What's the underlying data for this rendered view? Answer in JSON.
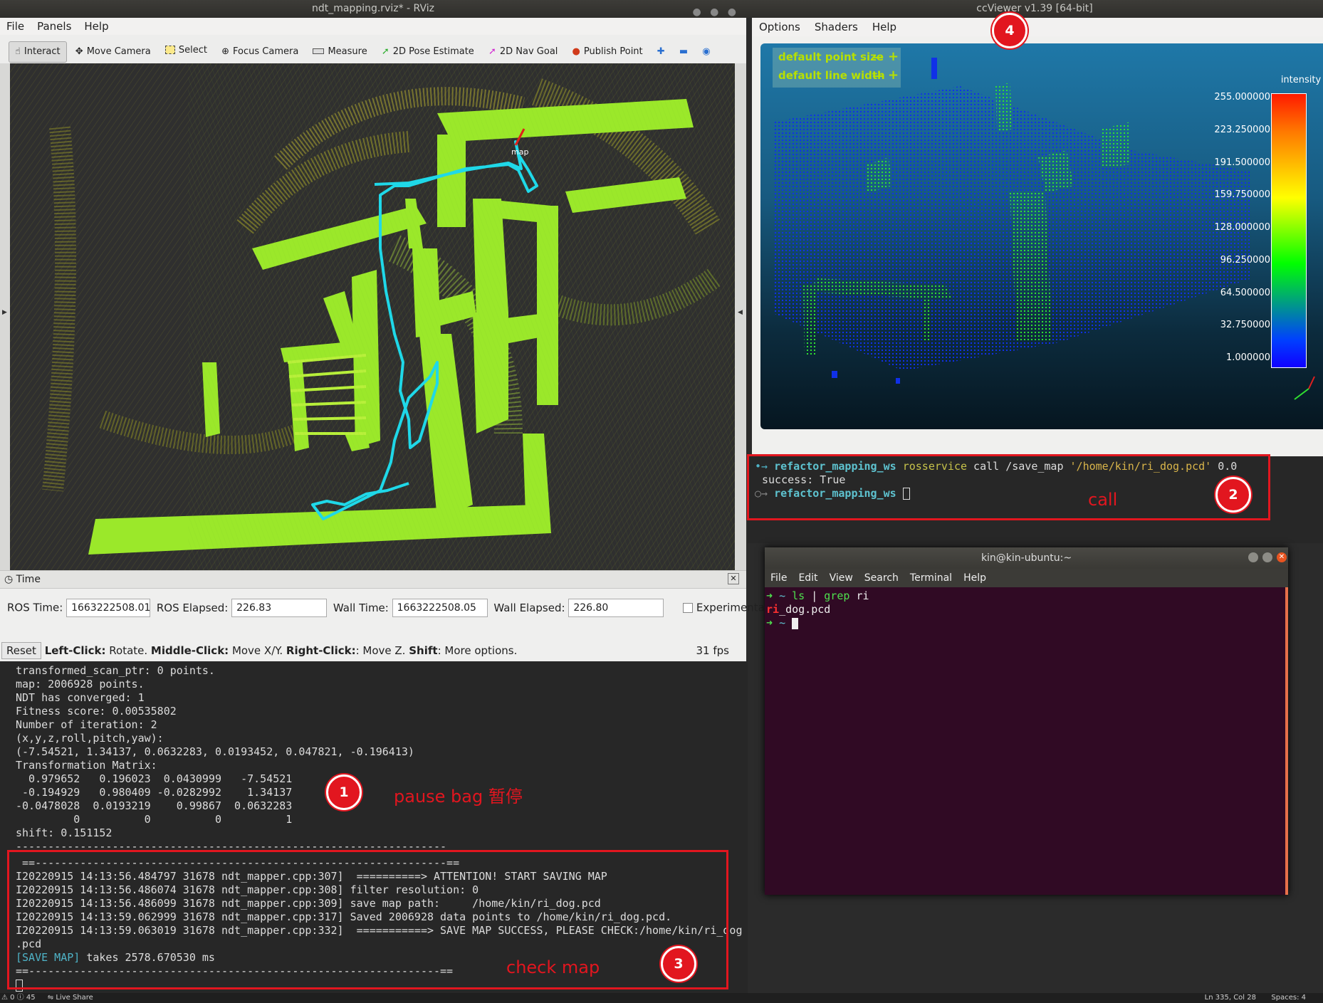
{
  "rviz": {
    "title": "ndt_mapping.rviz* - RViz",
    "menu": [
      "File",
      "Panels",
      "Help"
    ],
    "toolbar": [
      "Interact",
      "Move Camera",
      "Select",
      "Focus Camera",
      "Measure",
      "2D Pose Estimate",
      "2D Nav Goal",
      "Publish Point"
    ],
    "viewport_frame_label": "map",
    "time_panel": {
      "title": "Time",
      "ros_time_label": "ROS Time:",
      "ros_time": "1663222508.01",
      "ros_elapsed_label": "ROS Elapsed:",
      "ros_elapsed": "226.83",
      "wall_time_label": "Wall Time:",
      "wall_time": "1663222508.05",
      "wall_elapsed_label": "Wall Elapsed:",
      "wall_elapsed": "226.80",
      "experimental_label": "Experimental"
    },
    "status": {
      "reset": "Reset",
      "left_click": "Left-Click:",
      "left_click_desc": " Rotate. ",
      "middle_click": "Middle-Click:",
      "middle_click_desc": " Move X/Y. ",
      "right_click": "Right-Click:",
      "right_click_desc": ": Move Z. ",
      "shift": "Shift",
      "shift_desc": ": More options.",
      "fps": "31 fps"
    }
  },
  "ccviewer": {
    "title": "ccViewer v1.39 [64-bit]",
    "menu": [
      "Options",
      "Shaders",
      "Help"
    ],
    "point_size_label": "default point size",
    "line_width_label": "default line width",
    "minus": "—",
    "plus": "+",
    "scale_title": "intensity",
    "scale_ticks": [
      "255.000000",
      "223.250000",
      "191.500000",
      "159.750000",
      "128.000000",
      "96.250000",
      "64.500000",
      "32.750000",
      "1.000000"
    ]
  },
  "log_terminal": {
    "lines": [
      "transformed_scan_ptr: 0 points.",
      "map: 2006928 points.",
      "NDT has converged: 1",
      "Fitness score: 0.00535802",
      "Number of iteration: 2",
      "(x,y,z,roll,pitch,yaw):",
      "(-7.54521, 1.34137, 0.0632283, 0.0193452, 0.047821, -0.196413)",
      "Transformation Matrix:",
      "  0.979652   0.196023  0.0430999   -7.54521",
      " -0.194929   0.980409 -0.0282992    1.34137",
      "-0.0478028  0.0193219    0.99867  0.0632283",
      "         0          0          0          1",
      "shift: 0.151152",
      "-------------------------------------------------------------------"
    ],
    "save_lines": [
      " ==----------------------------------------------------------------==",
      "I20220915 14:13:56.484797 31678 ndt_mapper.cpp:307]  ==========> ATTENTION! START SAVING MAP",
      "I20220915 14:13:56.486074 31678 ndt_mapper.cpp:308] filter resolution: 0",
      "I20220915 14:13:56.486099 31678 ndt_mapper.cpp:309] save map path:     /home/kin/ri_dog.pcd",
      "I20220915 14:13:59.062999 31678 ndt_mapper.cpp:317] Saved 2006928 data points to /home/kin/ri_dog.pcd.",
      "I20220915 14:13:59.063019 31678 ndt_mapper.cpp:332]  ===========> SAVE MAP SUCCESS, PLEASE CHECK:/home/kin/ri_dog",
      ".pcd"
    ],
    "save_map_tag": "[SAVE MAP]",
    "save_map_rest": " takes 2578.670530 ms",
    "last_divider": "==----------------------------------------------------------------=="
  },
  "call_terminal": {
    "cwd": "refactor_mapping_ws",
    "cmd": "rosservice",
    "args": " call /save_map ",
    "path_arg": "'/home/kin/ri_dog.pcd'",
    "tail": " 0.0",
    "result": "success: True"
  },
  "ubuntu_terminal": {
    "title": "kin@kin-ubuntu:~",
    "menu": [
      "File",
      "Edit",
      "View",
      "Search",
      "Terminal",
      "Help"
    ],
    "prompt_tilde": "~",
    "cmd_ls": "ls",
    "pipe": "|",
    "cmd_grep": "grep",
    "grep_arg": "ri",
    "match": "ri",
    "match_rest": "_dog.pcd"
  },
  "annotations": {
    "n1": "1",
    "t1": "pause bag 暂停",
    "n2": "2",
    "t2": "call",
    "n3": "3",
    "t3": "check map",
    "n4": "4"
  },
  "statusbar": {
    "left": "⚠ 0 ⓘ 45",
    "live_share": "Live Share",
    "position": "Ln 335, Col 28",
    "spaces": "Spaces: 4"
  },
  "colors": {
    "annotation_red": "#e2161f",
    "trajectory": "#1fd8e8",
    "cc_bg_top": "#1b6f9e",
    "terminal_purple": "#300a24"
  }
}
